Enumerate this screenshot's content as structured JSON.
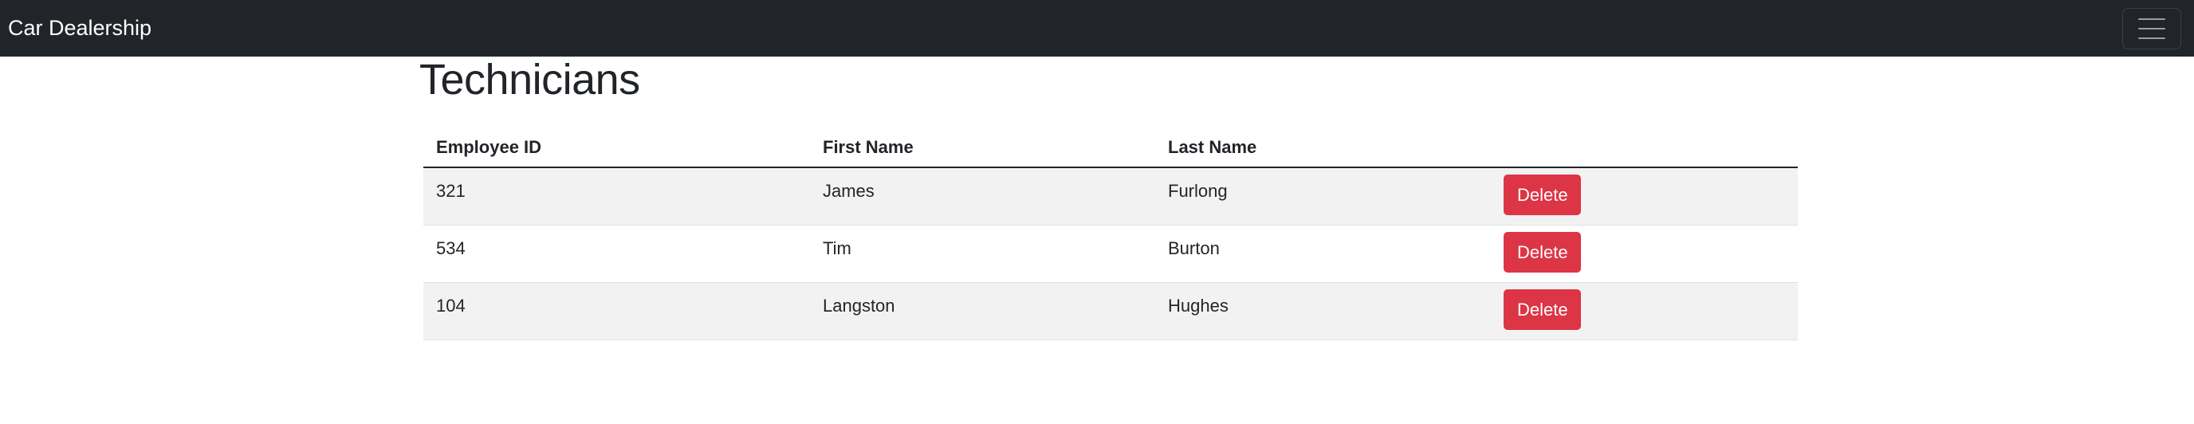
{
  "navbar": {
    "brand": "Car Dealership",
    "toggler_icon": "hamburger-menu-icon"
  },
  "page": {
    "title": "Technicians"
  },
  "table": {
    "columns": [
      "Employee ID",
      "First Name",
      "Last Name",
      ""
    ],
    "rows": [
      {
        "employee_id": "321",
        "first_name": "James",
        "last_name": "Furlong",
        "action": "Delete"
      },
      {
        "employee_id": "534",
        "first_name": "Tim",
        "last_name": "Burton",
        "action": "Delete"
      },
      {
        "employee_id": "104",
        "first_name": "Langston",
        "last_name": "Hughes",
        "action": "Delete"
      }
    ]
  },
  "colors": {
    "navbar_bg": "#212529",
    "danger": "#dc3545",
    "stripe": "#f2f2f2"
  }
}
